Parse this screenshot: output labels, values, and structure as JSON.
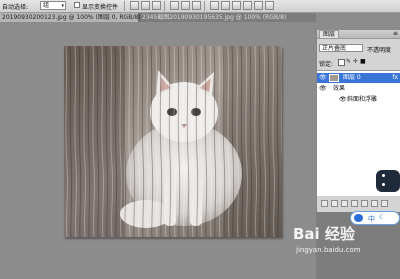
{
  "options_bar": {
    "select_label": "自动选择:",
    "select_value": "组",
    "transform_label": "显示变换控件"
  },
  "tabs": [
    {
      "label": "20190930200123.jpg @ 100% (图层 0, RGB/8) *",
      "active": true
    },
    {
      "label": "2345截图20190930195635.jpg @ 100% (RGB/8)",
      "active": false
    }
  ],
  "layers_panel": {
    "tab_label": "图层",
    "blend_mode": "正片叠底",
    "opacity_label": "不透明度",
    "lock_label": "锁定:",
    "layers": [
      {
        "name": "图层 0",
        "kind": "layer",
        "selected": true
      },
      {
        "name": "效果",
        "kind": "effects-group",
        "selected": false
      },
      {
        "name": "斜面和浮雕",
        "kind": "effect",
        "selected": false
      }
    ]
  },
  "ime": {
    "mode": "中"
  },
  "watermark": {
    "brand": "Bai 经验",
    "url": "jingyan.baidu.com"
  },
  "colors": {
    "selection_blue": "#3875d7",
    "canvas_gray": "#8c8c8c",
    "panel_gray": "#d4d4d4"
  }
}
